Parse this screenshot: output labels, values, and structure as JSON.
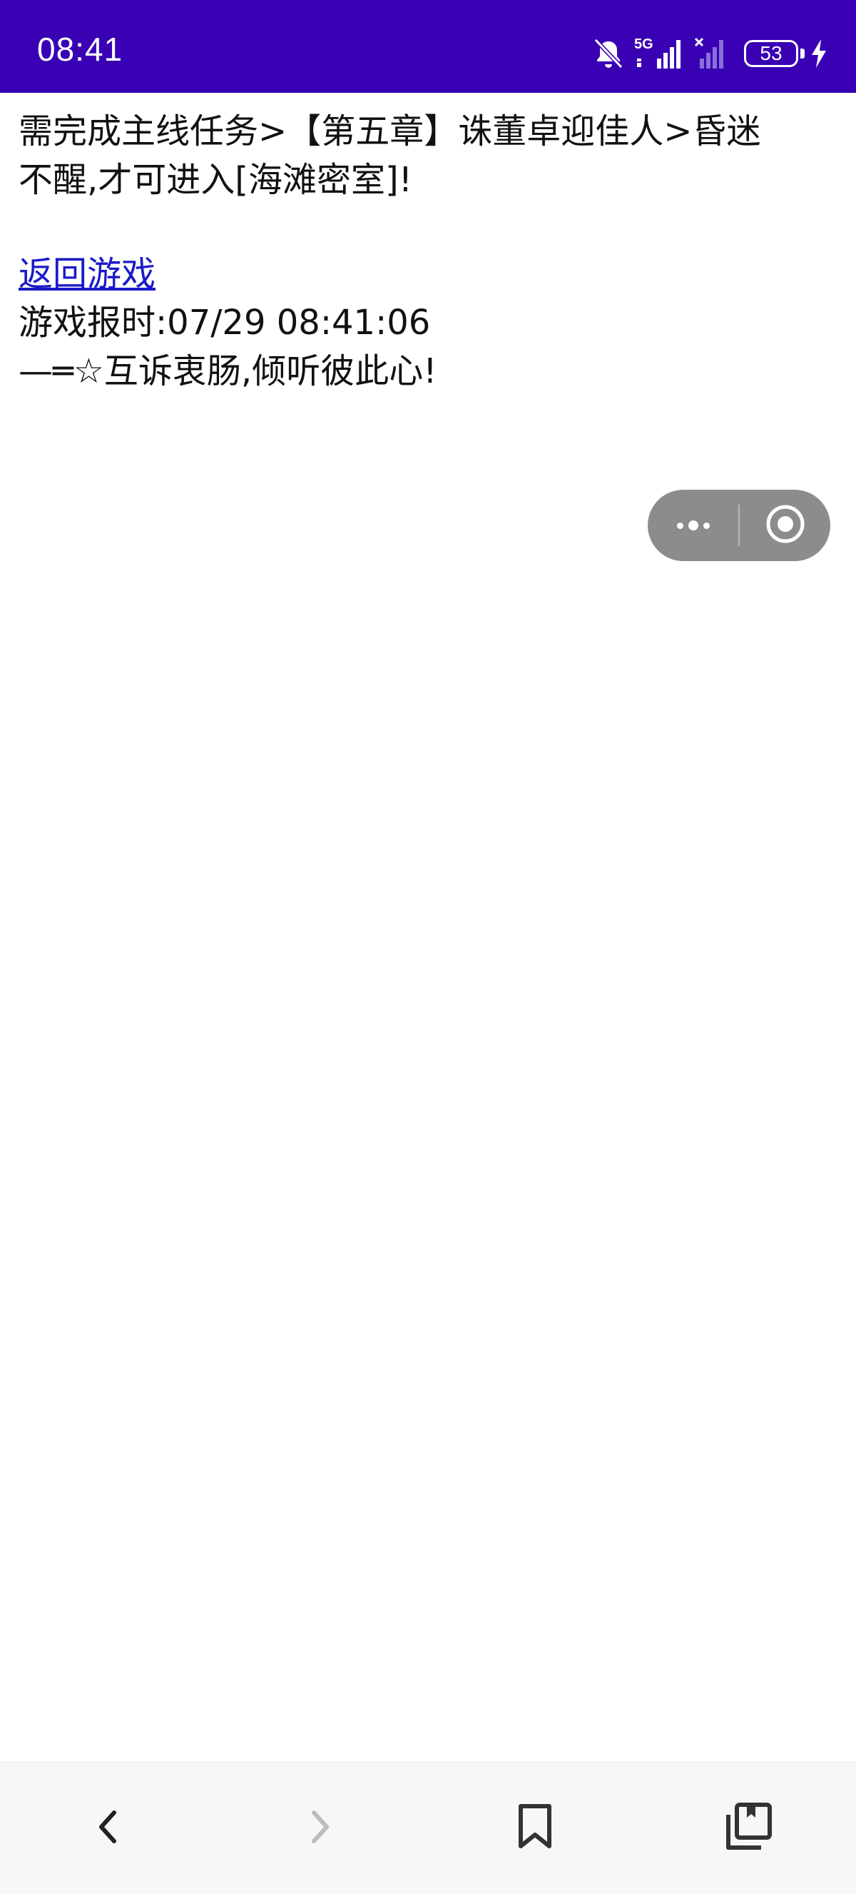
{
  "status_bar": {
    "time": "08:41",
    "battery_level": "53",
    "network_label": "5G",
    "icons": [
      "bell-muted-icon",
      "signal-5g-icon",
      "signal-no-sim-icon",
      "battery-icon",
      "charging-bolt-icon"
    ],
    "background_color": "#3a00b4"
  },
  "content": {
    "notice_line1": "需完成主线任务>【第五章】诛董卓迎佳人>昏迷",
    "notice_line2": "不醒,才可进入[海滩密室]!",
    "back_link": "返回游戏",
    "time_report": "游戏报时:07/29 08:41:06",
    "slogan": "—═☆互诉衷肠,倾听彼此心!",
    "link_color": "#1a1ac8"
  },
  "capsule": {
    "icons": [
      "more-dots-icon",
      "close-target-icon"
    ],
    "background_color": "#8c8c8c"
  },
  "bottom_nav": {
    "icons": [
      "back-arrow-icon",
      "forward-arrow-icon",
      "bookmark-icon",
      "tabs-icon"
    ]
  }
}
